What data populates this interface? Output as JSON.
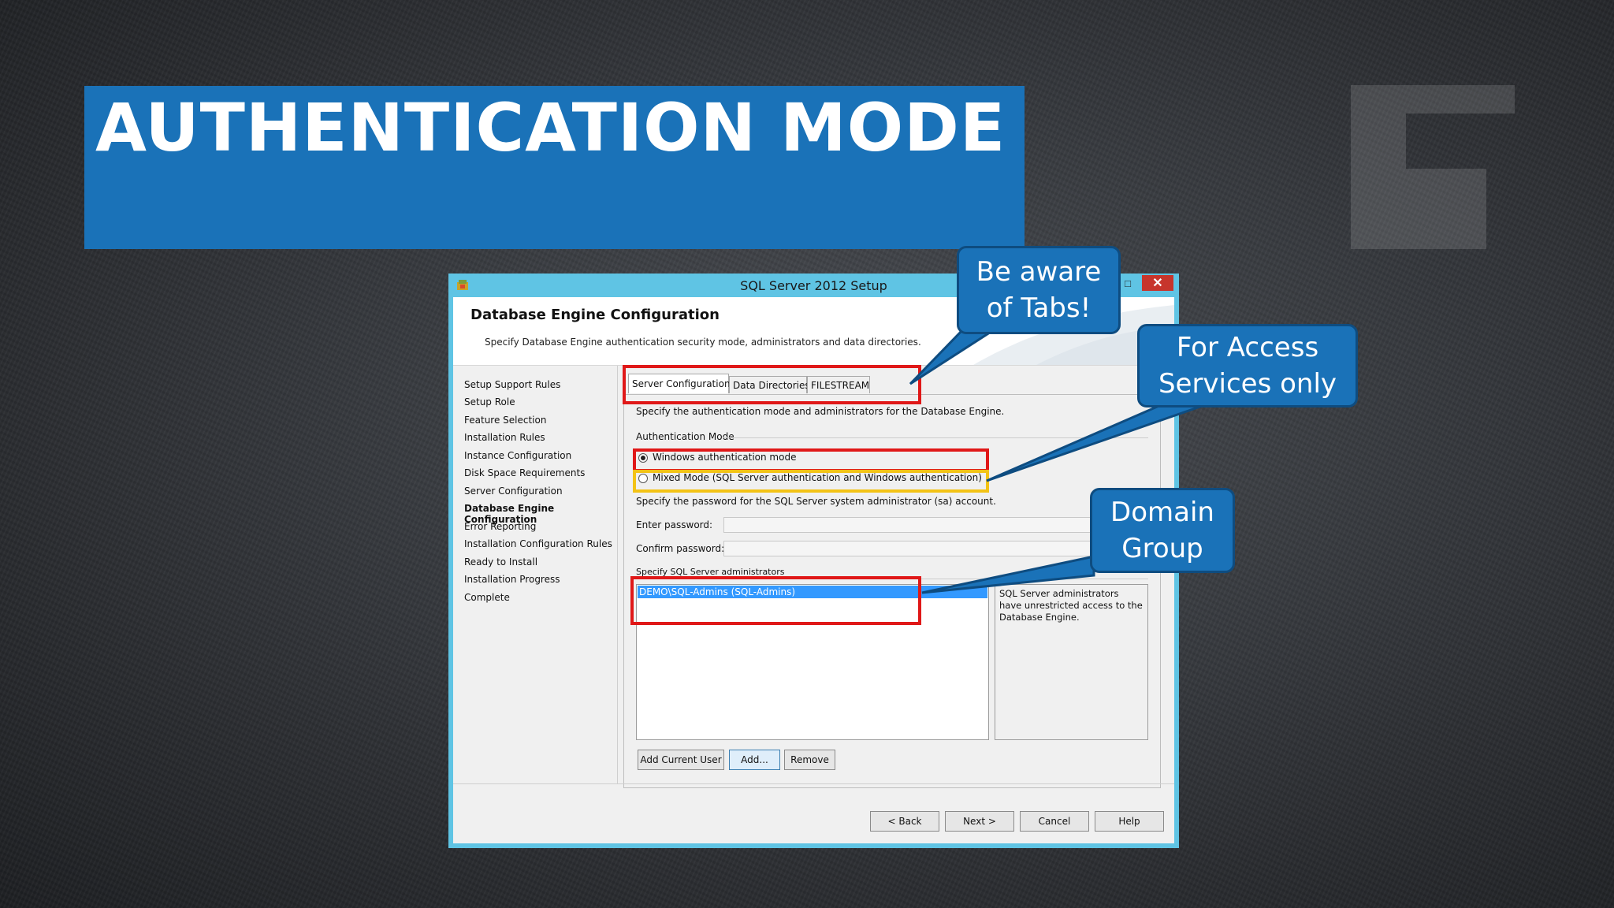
{
  "slide": {
    "title": "AUTHENTICATION MODE"
  },
  "window": {
    "title": "SQL Server 2012 Setup",
    "maximize_glyph": "□",
    "close_glyph": "✕"
  },
  "header": {
    "title": "Database Engine Configuration",
    "description": "Specify Database Engine authentication security mode, administrators and data directories."
  },
  "nav": {
    "items": [
      {
        "label": "Setup Support Rules"
      },
      {
        "label": "Setup Role"
      },
      {
        "label": "Feature Selection"
      },
      {
        "label": "Installation Rules"
      },
      {
        "label": "Instance Configuration"
      },
      {
        "label": "Disk Space Requirements"
      },
      {
        "label": "Server Configuration"
      },
      {
        "label": "Database Engine Configuration"
      },
      {
        "label": "Error Reporting"
      },
      {
        "label": "Installation Configuration Rules"
      },
      {
        "label": "Ready to Install"
      },
      {
        "label": "Installation Progress"
      },
      {
        "label": "Complete"
      }
    ],
    "active_index": 7
  },
  "tabs": [
    {
      "label": "Server Configuration"
    },
    {
      "label": "Data Directories"
    },
    {
      "label": "FILESTREAM"
    }
  ],
  "server_config": {
    "intro": "Specify the authentication mode and administrators for the Database Engine.",
    "auth_group_label": "Authentication Mode",
    "windows_auth_label": "Windows authentication mode",
    "mixed_mode_label": "Mixed Mode (SQL Server authentication and Windows authentication)",
    "selected_mode": "windows",
    "sa_password_intro": "Specify the password for the SQL Server system administrator (sa) account.",
    "enter_password_label": "Enter password:",
    "confirm_password_label": "Confirm password:",
    "admins_label": "Specify SQL Server administrators",
    "admins": [
      "DEMO\\SQL-Admins (SQL-Admins)"
    ],
    "admins_info": "SQL Server administrators have unrestricted access to the Database Engine.",
    "add_current_user_label": "Add Current User",
    "add_label": "Add...",
    "remove_label": "Remove"
  },
  "footer": {
    "back_label": "< Back",
    "next_label": "Next >",
    "cancel_label": "Cancel",
    "help_label": "Help"
  },
  "callouts": {
    "tabs": {
      "line1": "Be aware",
      "line2": "of Tabs!"
    },
    "access": {
      "line1": "For Access",
      "line2": "Services only"
    },
    "domain": {
      "line1": "Domain",
      "line2": "Group"
    }
  },
  "colors": {
    "accent": "#1a72b8",
    "window_frame": "#5fc4e4",
    "highlight_red": "#e01818",
    "highlight_yellow": "#f3c316"
  }
}
